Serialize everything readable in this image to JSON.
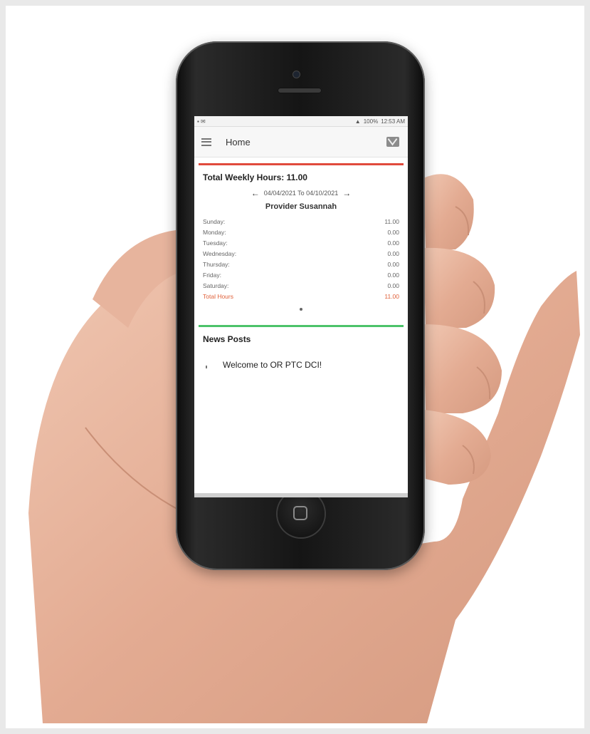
{
  "app": {
    "title": "Home"
  },
  "statusbar": {
    "battery": "100%",
    "time": "12:53 AM"
  },
  "hours_card": {
    "title": "Total Weekly Hours: 11.00",
    "prev_arrow": "←",
    "date_range": "04/04/2021 To 04/10/2021",
    "next_arrow": "→",
    "provider": "Provider Susannah",
    "rows": [
      {
        "day": "Sunday:",
        "hours": "11.00"
      },
      {
        "day": "Monday:",
        "hours": "0.00"
      },
      {
        "day": "Tuesday:",
        "hours": "0.00"
      },
      {
        "day": "Wednesday:",
        "hours": "0.00"
      },
      {
        "day": "Thursday:",
        "hours": "0.00"
      },
      {
        "day": "Friday:",
        "hours": "0.00"
      },
      {
        "day": "Saturday:",
        "hours": "0.00"
      }
    ],
    "total_label": "Total Hours",
    "total_value": "11.00"
  },
  "news_card": {
    "title": "News Posts",
    "welcome_text": "Welcome to OR PTC DCI!"
  },
  "colors": {
    "hours_accent": "#e04a3c",
    "news_accent": "#4cc36a",
    "total_text": "#e0613a"
  },
  "icons": {
    "menu": "hamburger-menu-icon",
    "mail": "mail-icon",
    "prev": "arrow-left-icon",
    "next": "arrow-right-icon",
    "home": "home-button-icon"
  }
}
